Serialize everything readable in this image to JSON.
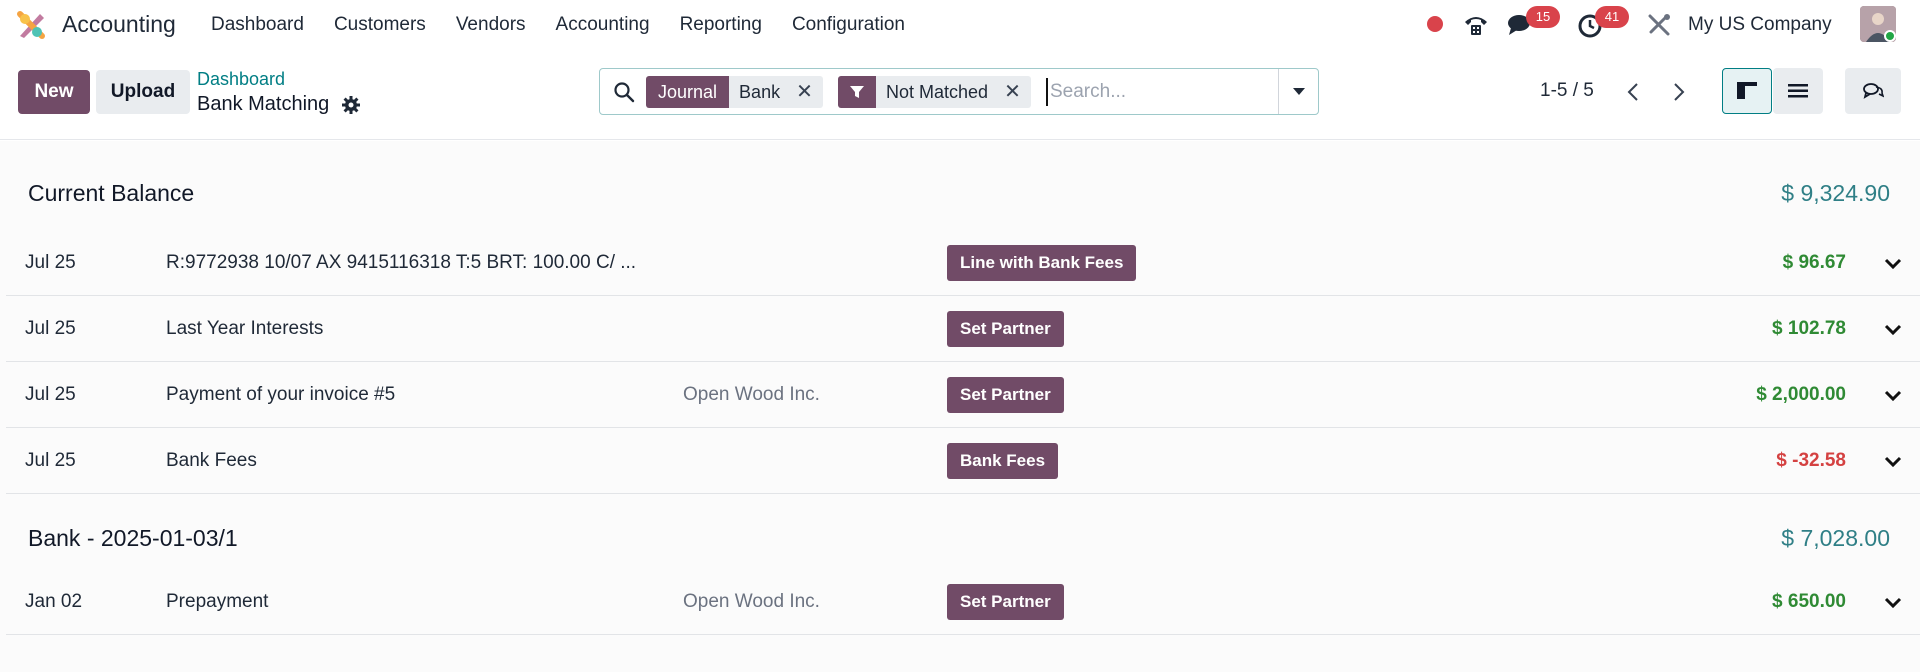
{
  "navbar": {
    "app_name": "Accounting",
    "menu": [
      "Dashboard",
      "Customers",
      "Vendors",
      "Accounting",
      "Reporting",
      "Configuration"
    ],
    "messages_count": "15",
    "activities_count": "41",
    "company": "My US Company"
  },
  "control": {
    "new_label": "New",
    "upload_label": "Upload",
    "breadcrumb": "Dashboard",
    "title": "Bank Matching",
    "search": {
      "facet1_label": "Journal",
      "facet1_value": "Bank",
      "facet2_value": "Not Matched",
      "placeholder": "Search..."
    },
    "pager": "1-5 / 5"
  },
  "groups": [
    {
      "title": "Current Balance",
      "balance": "$ 9,324.90",
      "rows": [
        {
          "date": "Jul 25",
          "label": "R:9772938 10/07 AX 9415116318 T:5 BRT: 100.00 C/ ...",
          "partner": "",
          "action": "Line with Bank Fees",
          "amount": "$ 96.67",
          "sign": "pos"
        },
        {
          "date": "Jul 25",
          "label": "Last Year Interests",
          "partner": "",
          "action": "Set Partner",
          "amount": "$ 102.78",
          "sign": "pos"
        },
        {
          "date": "Jul 25",
          "label": "Payment of your invoice #5",
          "partner": "Open Wood Inc.",
          "action": "Set Partner",
          "amount": "$ 2,000.00",
          "sign": "pos"
        },
        {
          "date": "Jul 25",
          "label": "Bank Fees",
          "partner": "",
          "action": "Bank Fees",
          "amount": "$ -32.58",
          "sign": "neg"
        }
      ]
    },
    {
      "title": "Bank - 2025-01-03/1",
      "balance": "$ 7,028.00",
      "rows": [
        {
          "date": "Jan 02",
          "label": "Prepayment",
          "partner": "Open Wood Inc.",
          "action": "Set Partner",
          "amount": "$ 650.00",
          "sign": "pos"
        }
      ]
    }
  ],
  "colors": {
    "brand": "#714b67",
    "accent": "#017e84",
    "positive": "#2f8a34",
    "negative": "#d44141",
    "balance": "#2f7f86"
  }
}
